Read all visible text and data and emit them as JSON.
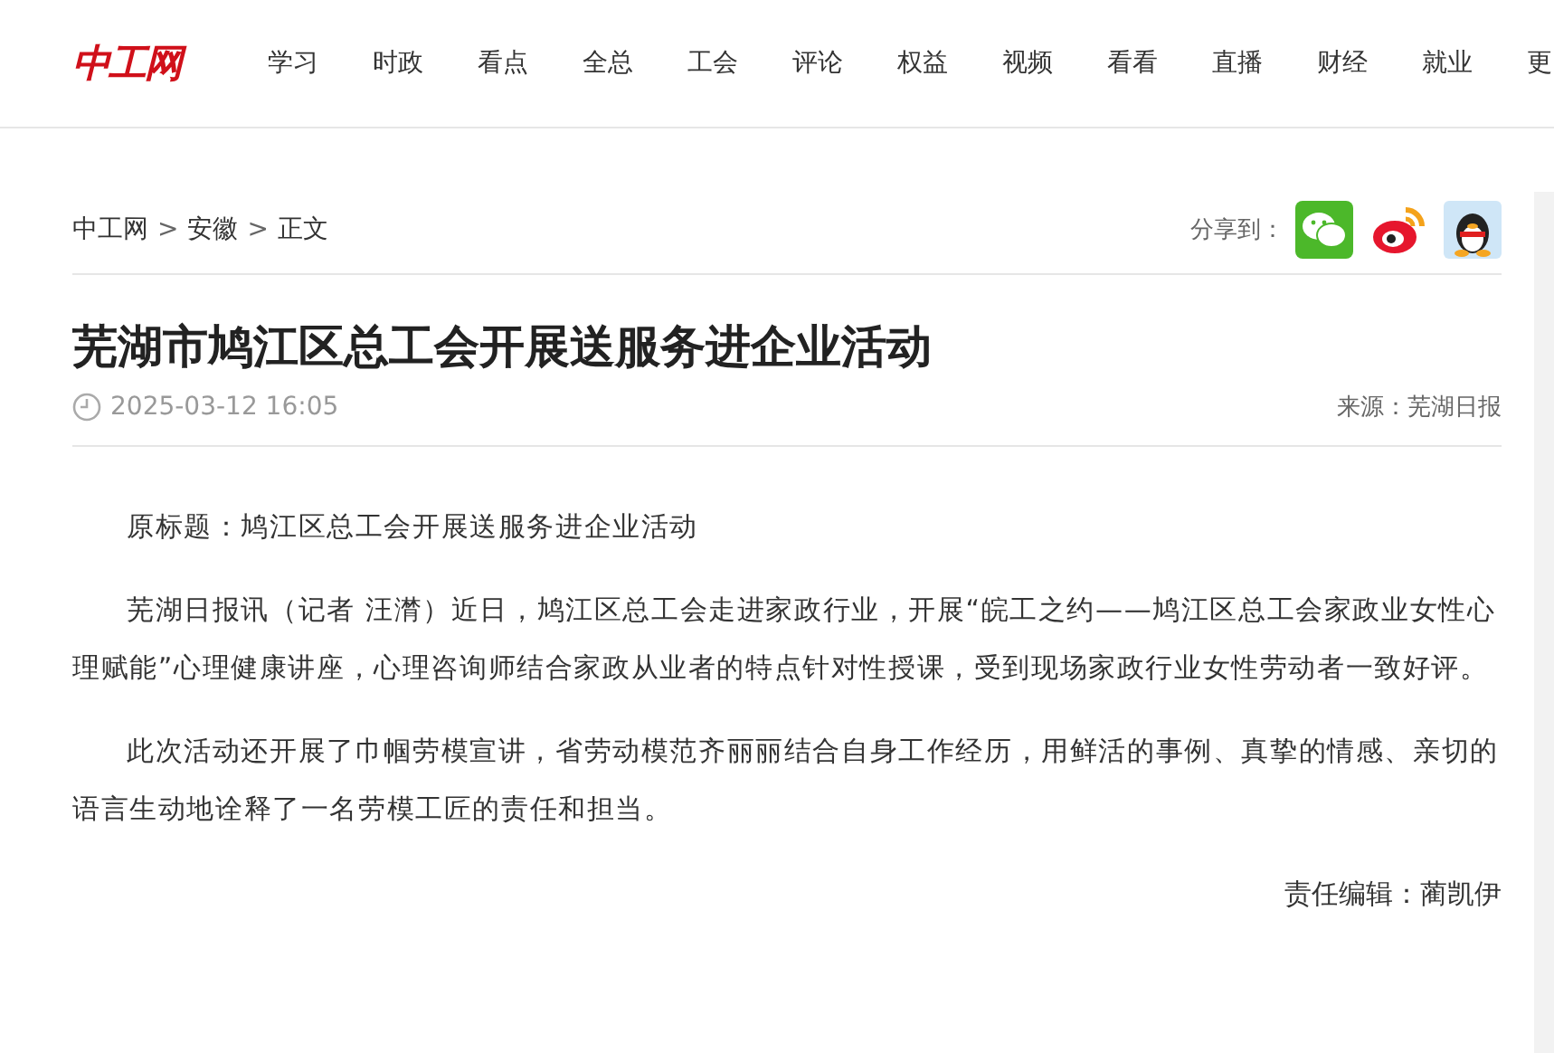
{
  "header": {
    "logo": "中工网",
    "nav": [
      "学习",
      "时政",
      "看点",
      "全总",
      "工会",
      "评论",
      "权益",
      "视频",
      "看看",
      "直播",
      "财经",
      "就业",
      "更"
    ]
  },
  "breadcrumb": {
    "links": [
      "中工网",
      "安徽"
    ],
    "separator": ">",
    "current": "正文"
  },
  "share": {
    "label": "分享到：",
    "targets": [
      {
        "kind": "wechat"
      },
      {
        "kind": "weibo"
      },
      {
        "kind": "qq"
      }
    ]
  },
  "article": {
    "title": "芜湖市鸠江区总工会开展送服务进企业活动",
    "time": "2025-03-12 16:05",
    "source": "来源：芜湖日报",
    "paragraphs": [
      "原标题：鸠江区总工会开展送服务进企业活动",
      "芜湖日报讯（记者 汪潸）近日，鸠江区总工会走进家政行业，开展“皖工之约——鸠江区总工会家政业女性心理赋能”心理健康讲座，心理咨询师结合家政从业者的特点针对性授课，受到现场家政行业女性劳动者一致好评。",
      "此次活动还开展了巾帼劳模宣讲，省劳动模范齐丽丽结合自身工作经历，用鲜活的事例、真挚的情感、亲切的语言生动地诠释了一名劳模工匠的责任和担当。"
    ],
    "editor": "责任编辑：蔺凯伊"
  }
}
